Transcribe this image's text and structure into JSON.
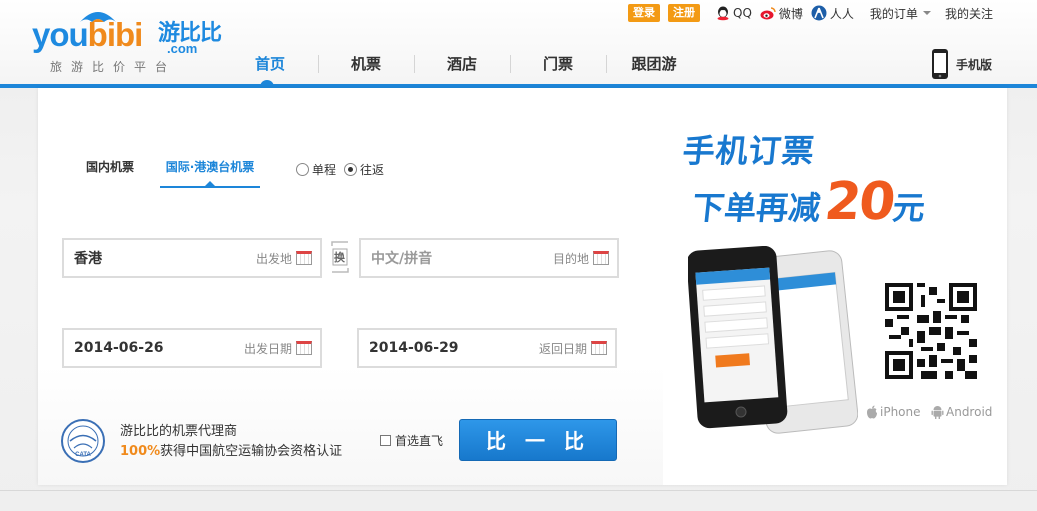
{
  "brand": {
    "logo_word_a": "you",
    "logo_word_b": "bibi",
    "logo_cn": "游比比",
    "logo_com": ".com",
    "tagline": "旅游比价平台"
  },
  "top_links": {
    "login": "登录",
    "register": "注册",
    "qq": "QQ",
    "weibo": "微博",
    "renren": "人人",
    "my_orders": "我的订单",
    "my_follow": "我的关注"
  },
  "nav": {
    "items": [
      {
        "label": "首页",
        "active": true
      },
      {
        "label": "机票",
        "active": false
      },
      {
        "label": "酒店",
        "active": false
      },
      {
        "label": "门票",
        "active": false
      },
      {
        "label": "跟团游",
        "active": false
      }
    ],
    "mobile": "手机版"
  },
  "search": {
    "tabs": [
      {
        "label": "国内机票",
        "active": false
      },
      {
        "label": "国际·港澳台机票",
        "active": true
      }
    ],
    "trip_types": [
      {
        "label": "单程",
        "selected": false
      },
      {
        "label": "往返",
        "selected": true
      }
    ],
    "from": {
      "value": "香港",
      "hint": "出发地"
    },
    "to": {
      "placeholder": "中文/拼音",
      "hint": "目的地"
    },
    "swap_label": "换",
    "depart": {
      "value": "2014-06-26",
      "hint": "出发日期"
    },
    "return": {
      "value": "2014-06-29",
      "hint": "返回日期"
    },
    "agent_line1": "游比比的机票代理商",
    "agent_pct": "100%",
    "agent_line2": "获得中国航空运输协会资格认证",
    "caac_label": "CATA",
    "direct_only": "首选直飞",
    "submit": "比 一 比"
  },
  "ad": {
    "line1": "手机订票",
    "line2": "下单再减",
    "amount": "20",
    "unit": "元",
    "iphone": "iPhone",
    "android": "Android"
  },
  "colors": {
    "brand_blue": "#1d86d9",
    "orange": "#f39a14",
    "ad_red": "#ef5a1e"
  }
}
